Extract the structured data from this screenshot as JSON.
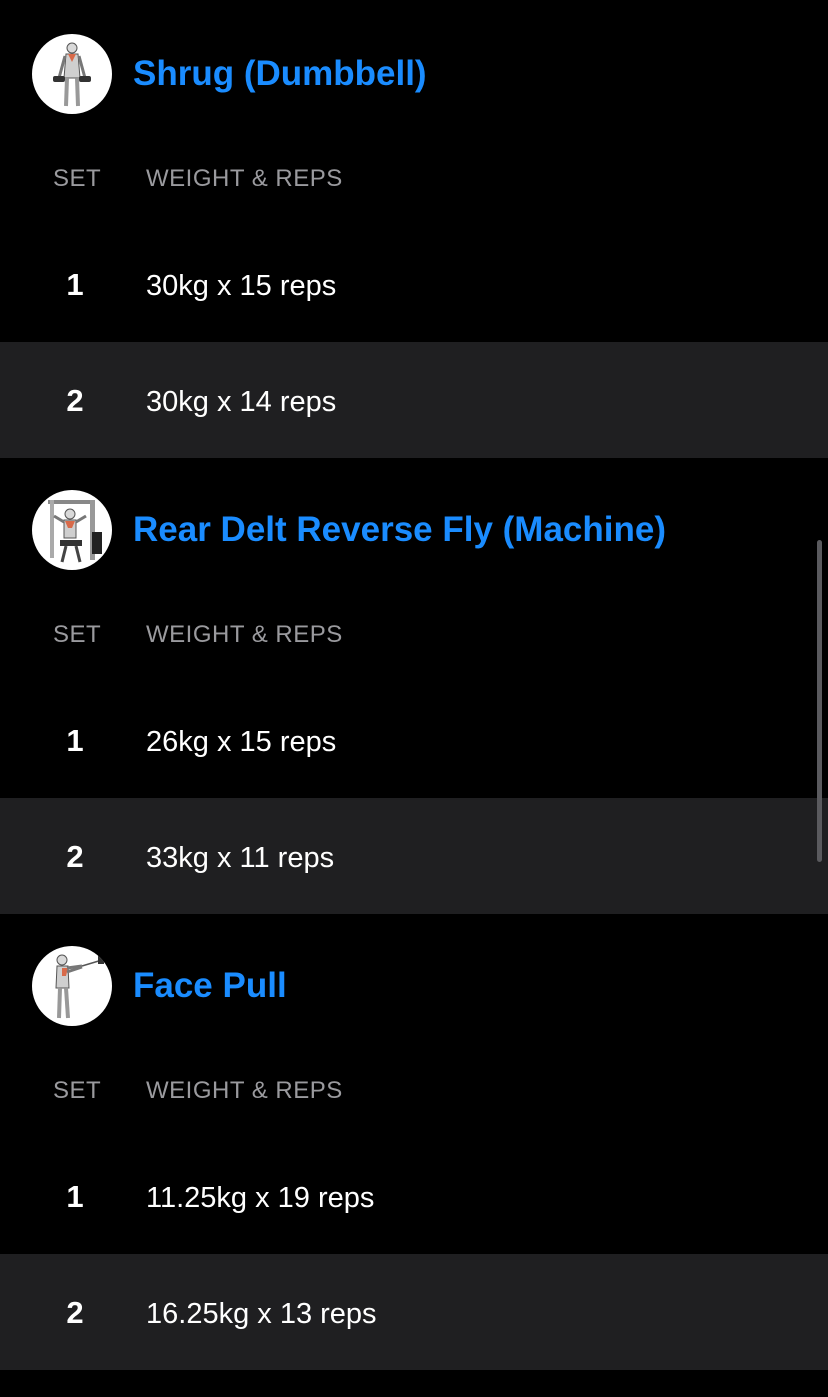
{
  "exercises": [
    {
      "name": "Shrug (Dumbbell)",
      "icon": "shrug-dumbbell-illustration",
      "col_set": "SET",
      "col_weight_reps": "WEIGHT & REPS",
      "sets": [
        {
          "set": "1",
          "value": "30kg x 15 reps"
        },
        {
          "set": "2",
          "value": "30kg x 14 reps"
        }
      ]
    },
    {
      "name": "Rear Delt Reverse Fly (Machine)",
      "icon": "rear-delt-machine-illustration",
      "col_set": "SET",
      "col_weight_reps": "WEIGHT & REPS",
      "sets": [
        {
          "set": "1",
          "value": "26kg x 15 reps"
        },
        {
          "set": "2",
          "value": "33kg x 11 reps"
        }
      ]
    },
    {
      "name": "Face Pull",
      "icon": "face-pull-illustration",
      "col_set": "SET",
      "col_weight_reps": "WEIGHT & REPS",
      "sets": [
        {
          "set": "1",
          "value": "11.25kg x 19 reps"
        },
        {
          "set": "2",
          "value": "16.25kg x 13 reps"
        }
      ]
    }
  ],
  "colors": {
    "background": "#000000",
    "alt_row": "#1f1f21",
    "accent": "#1a8cff",
    "muted_text": "#9a9a9e"
  }
}
